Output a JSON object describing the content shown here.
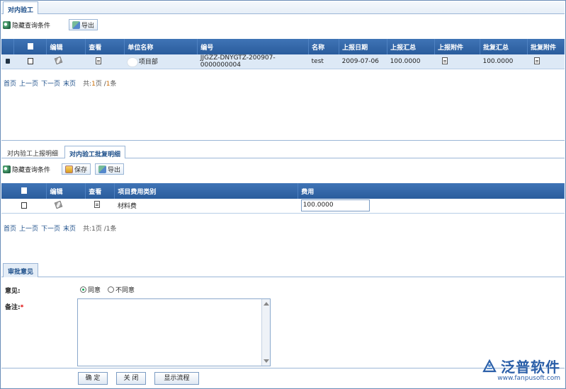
{
  "top_tab": {
    "label": "对内验工"
  },
  "toolbar1": {
    "hide_query": "隐藏查询条件",
    "export": "导出"
  },
  "grid1": {
    "headers": [
      "",
      "编辑",
      "查看",
      "单位名称",
      "编号",
      "名称",
      "上报日期",
      "上报汇总",
      "上报附件",
      "批复汇总",
      "批复附件"
    ],
    "row": {
      "unit": "项目部",
      "code": "JJGZZ-DNYGTZ-200907-0000000004",
      "name": "test",
      "date": "2009-07-06",
      "report_total": "100.0000",
      "approve_total": "100.0000"
    }
  },
  "pager1": {
    "first": "首页",
    "prev": "上一页",
    "next": "下一页",
    "last": "末页",
    "total_prefix": "共:",
    "pages": "1",
    "page_unit": "页",
    "slash": "/",
    "count": "1",
    "count_unit": "条"
  },
  "sub_tabs": {
    "tab1": "对内验工上报明细",
    "tab2": "对内验工批复明细"
  },
  "toolbar2": {
    "hide_query": "隐藏查询条件",
    "save": "保存",
    "export": "导出"
  },
  "grid2": {
    "headers": [
      "",
      "编辑",
      "查看",
      "项目费用类别",
      "费用"
    ],
    "row": {
      "category": "材料费",
      "fee": "100.0000"
    }
  },
  "pager2": {
    "first": "首页",
    "prev": "上一页",
    "next": "下一页",
    "last": "末页",
    "total_prefix": "共:",
    "pages": "1",
    "page_unit": "页",
    "slash": "/",
    "count": "1",
    "count_unit": "条"
  },
  "approval": {
    "tab": "审批意见",
    "opinion_label": "意见:",
    "agree": "同意",
    "disagree": "不同意",
    "remark_label": "备注:",
    "remark_required": "*",
    "remark_value": ""
  },
  "buttons": {
    "confirm": "确 定",
    "close": "关 闭",
    "show_flow": "显示流程"
  },
  "brand": {
    "name": "泛普软件",
    "url": "www.fanpusoft.com",
    "color": "#2b5fa8"
  }
}
